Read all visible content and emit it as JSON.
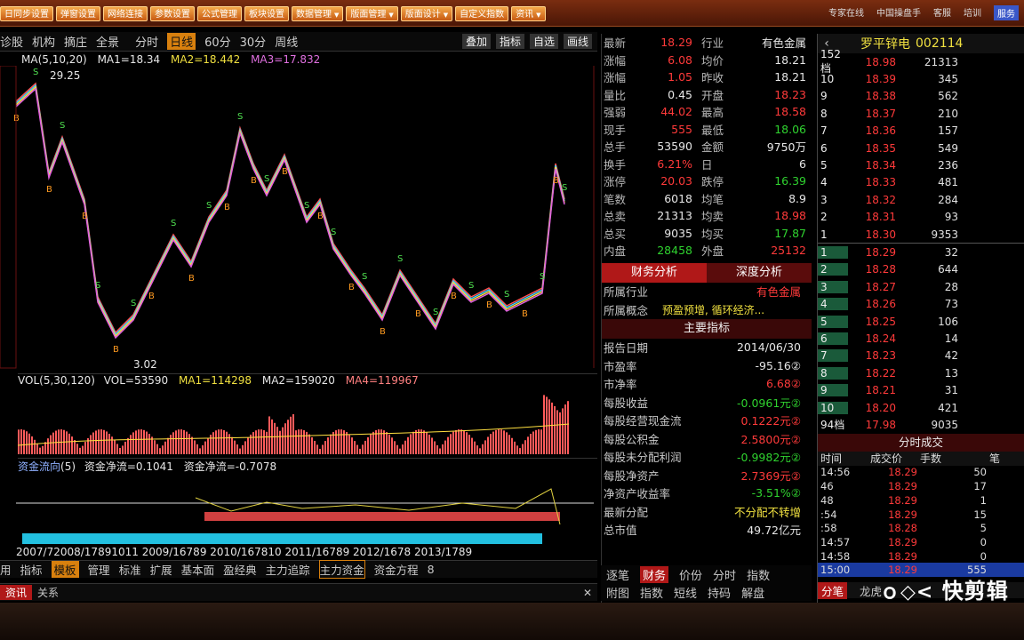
{
  "menu": [
    {
      "label": "日同步设置",
      "dd": false
    },
    {
      "label": "弹窗设置",
      "dd": false
    },
    {
      "label": "网络连接",
      "dd": false
    },
    {
      "label": "参数设置",
      "dd": false
    },
    {
      "label": "公式管理",
      "dd": false
    },
    {
      "label": "板块设置",
      "dd": false
    },
    {
      "label": "数据管理",
      "dd": true
    },
    {
      "label": "版面管理",
      "dd": true
    },
    {
      "label": "版面设计",
      "dd": true
    },
    {
      "label": "自定义指数",
      "dd": false
    },
    {
      "label": "资讯",
      "dd": true
    }
  ],
  "top_right": [
    "专家在线",
    "中国操盘手",
    "客服",
    "培训",
    "服务"
  ],
  "chart_toolbar": {
    "left": [
      "诊股",
      "机构",
      "摘庄",
      "全景"
    ],
    "periods": [
      "分时",
      "日线",
      "60分",
      "30分",
      "周线"
    ],
    "active_period": "日线",
    "right": [
      "叠加",
      "指标",
      "自选",
      "画线"
    ]
  },
  "ma_header": {
    "name": "MA",
    "params": "(5,10,20)",
    "ma1": "MA1=18.34",
    "ma2": "MA2=18.442",
    "ma3": "MA3=17.832"
  },
  "price_labels": {
    "high": "29.25",
    "low": "3.02"
  },
  "vol_header": {
    "name": "VOL",
    "params": "(5,30,120)",
    "vol": "VOL=53590",
    "ma1": "MA1=114298",
    "ma2": "MA2=159020",
    "ma4": "MA4=119967"
  },
  "fund_header": {
    "name": "资金流向",
    "params": "(5)",
    "a": "资金净流=0.1041",
    "b": "资金净流=-0.7078"
  },
  "x_axis": "2007/72008/17891011 2009/16789 2010/167810 2011/16789 2012/1678 2013/1789",
  "bottom_tabs": [
    "用",
    "指标",
    "模板",
    "管理",
    "标准",
    "扩展",
    "基本面",
    "盈经典",
    "主力追踪",
    "主力资金",
    "资金方程",
    "8"
  ],
  "active_bottom_tab": "模板",
  "news": {
    "label": "资讯",
    "tag": "关系"
  },
  "quote_rows": [
    {
      "k": "最新",
      "v": "18.29",
      "vc": "red",
      "k2": "行业",
      "v2": "有色金属",
      "c2": "wht"
    },
    {
      "k": "涨幅",
      "v": "6.08",
      "vc": "red",
      "k2": "均价",
      "v2": "18.21",
      "c2": "wht"
    },
    {
      "k": "涨幅",
      "v": "1.05",
      "vc": "red",
      "k2": "昨收",
      "v2": "18.21",
      "c2": "wht"
    },
    {
      "k": "量比",
      "v": "0.45",
      "vc": "wht",
      "k2": "开盘",
      "v2": "18.23",
      "c2": "red"
    },
    {
      "k": "强弱",
      "v": "44.02",
      "vc": "red",
      "k2": "最高",
      "v2": "18.58",
      "c2": "red"
    },
    {
      "k": "现手",
      "v": "555",
      "vc": "red",
      "k2": "最低",
      "v2": "18.06",
      "c2": "grn"
    },
    {
      "k": "总手",
      "v": "53590",
      "vc": "wht",
      "k2": "金额",
      "v2": "9750万",
      "c2": "wht"
    },
    {
      "k": "换手",
      "v": "6.21%",
      "vc": "red",
      "k2": "日",
      "v2": "6",
      "c2": "wht"
    },
    {
      "k": "涨停",
      "v": "20.03",
      "vc": "red",
      "k2": "跌停",
      "v2": "16.39",
      "c2": "grn"
    },
    {
      "k": "笔数",
      "v": "6018",
      "vc": "wht",
      "k2": "均笔",
      "v2": "8.9",
      "c2": "wht"
    },
    {
      "k": "总卖",
      "v": "21313",
      "vc": "wht",
      "k2": "均卖",
      "v2": "18.98",
      "c2": "red"
    },
    {
      "k": "总买",
      "v": "9035",
      "vc": "wht",
      "k2": "均买",
      "v2": "17.87",
      "c2": "grn"
    },
    {
      "k": "内盘",
      "v": "28458",
      "vc": "grn",
      "k2": "外盘",
      "v2": "25132",
      "c2": "red"
    }
  ],
  "info_tabs": [
    "财务分析",
    "深度分析"
  ],
  "industry": {
    "k": "所属行业",
    "v": "有色金属"
  },
  "concept": {
    "k": "所属概念",
    "v": "预盈预增, 循环经济..."
  },
  "main_indicator_title": "主要指标",
  "fin_rows": [
    {
      "k": "报告日期",
      "v": "2014/06/30",
      "c": "wht"
    },
    {
      "k": "市盈率",
      "v": "-95.16②",
      "c": "wht"
    },
    {
      "k": "市净率",
      "v": "6.68②",
      "c": "red"
    },
    {
      "k": "每股收益",
      "v": "-0.0961元②",
      "c": "grn"
    },
    {
      "k": "每股经营现金流",
      "v": "0.1222元②",
      "c": "red"
    },
    {
      "k": "每股公积金",
      "v": "2.5800元②",
      "c": "red"
    },
    {
      "k": "每股未分配利润",
      "v": "-0.9982元②",
      "c": "grn"
    },
    {
      "k": "每股净资产",
      "v": "2.7369元②",
      "c": "red"
    },
    {
      "k": "净资产收益率",
      "v": "-3.51%②",
      "c": "grn"
    },
    {
      "k": "最新分配",
      "v": "不分配不转增",
      "c": "yel"
    },
    {
      "k": "总市值",
      "v": "49.72亿元",
      "c": "wht"
    }
  ],
  "info_bottom": [
    "逐笔",
    "财务",
    "价份",
    "分时",
    "指数",
    "附图",
    "指数",
    "短线",
    "持码",
    "解盘"
  ],
  "book_header": {
    "left": "‹",
    "name": "罗平锌电",
    "code": "002114"
  },
  "asks_total": {
    "label": "152档",
    "price": "18.98",
    "qty": "21313"
  },
  "asks": [
    {
      "n": "10",
      "p": "18.39",
      "q": "345"
    },
    {
      "n": "9",
      "p": "18.38",
      "q": "562"
    },
    {
      "n": "8",
      "p": "18.37",
      "q": "210"
    },
    {
      "n": "7",
      "p": "18.36",
      "q": "157"
    },
    {
      "n": "6",
      "p": "18.35",
      "q": "549"
    },
    {
      "n": "5",
      "p": "18.34",
      "q": "236"
    },
    {
      "n": "4",
      "p": "18.33",
      "q": "481"
    },
    {
      "n": "3",
      "p": "18.32",
      "q": "284"
    },
    {
      "n": "2",
      "p": "18.31",
      "q": "93"
    },
    {
      "n": "1",
      "p": "18.30",
      "q": "9353"
    }
  ],
  "bids": [
    {
      "n": "1",
      "p": "18.29",
      "q": "32"
    },
    {
      "n": "2",
      "p": "18.28",
      "q": "644"
    },
    {
      "n": "3",
      "p": "18.27",
      "q": "28"
    },
    {
      "n": "4",
      "p": "18.26",
      "q": "73"
    },
    {
      "n": "5",
      "p": "18.25",
      "q": "106"
    },
    {
      "n": "6",
      "p": "18.24",
      "q": "14"
    },
    {
      "n": "7",
      "p": "18.23",
      "q": "42"
    },
    {
      "n": "8",
      "p": "18.22",
      "q": "13"
    },
    {
      "n": "9",
      "p": "18.21",
      "q": "31"
    },
    {
      "n": "10",
      "p": "18.20",
      "q": "421"
    }
  ],
  "bids_total": {
    "label": "94档",
    "price": "17.98",
    "qty": "9035"
  },
  "trades_title": "分时成交",
  "trades_cols": [
    "时间",
    "成交价",
    "手数",
    "笔"
  ],
  "trades": [
    {
      "t": "14:56",
      "p": "18.29",
      "q": "50"
    },
    {
      "t": "46",
      "p": "18.29",
      "q": "17"
    },
    {
      "t": "48",
      "p": "18.29",
      "q": "1"
    },
    {
      "t": ":54",
      "p": "18.29",
      "q": "15"
    },
    {
      "t": ":58",
      "p": "18.28",
      "q": "5"
    },
    {
      "t": "14:57",
      "p": "18.29",
      "q": "0"
    },
    {
      "t": "14:58",
      "p": "18.29",
      "q": "0"
    },
    {
      "t": "15:00",
      "p": "18.29",
      "q": "555"
    }
  ],
  "book_bottom": [
    "分笔",
    "龙虎"
  ],
  "watermark": "快剪辑"
}
